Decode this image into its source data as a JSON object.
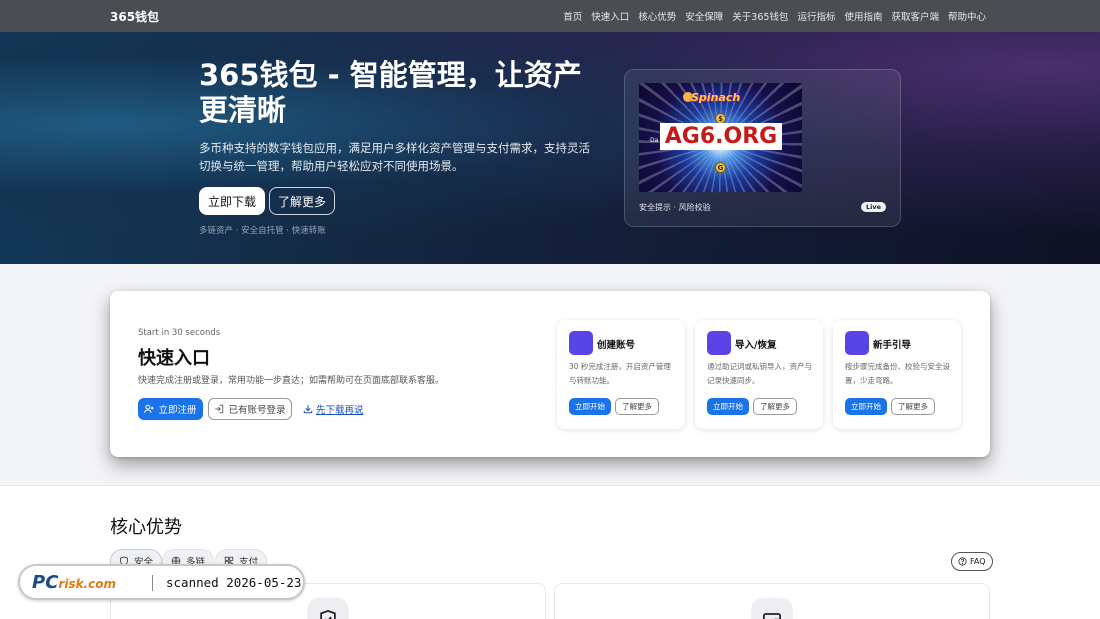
{
  "nav": {
    "brand": "365钱包",
    "links": [
      "首页",
      "快速入口",
      "核心优势",
      "安全保障",
      "关于365钱包",
      "运行指标",
      "使用指南",
      "获取客户端",
      "帮助中心"
    ]
  },
  "hero": {
    "title": "365钱包 - 智能管理，让资产更清晰",
    "description": "多币种支持的数字钱包应用，满足用户多样化资产管理与支付需求，支持灵活切换与统一管理，帮助用户轻松应对不同使用场景。",
    "download_label": "立即下载",
    "learn_label": "了解更多",
    "tags": "多链资产 · 安全自托管 · 快速转账",
    "card": {
      "promo_brand": "Spinach",
      "promo_headline": "AG6.ORG",
      "promo_small": "Da",
      "caption": "安全提示 · 风险校验",
      "badge": "Live"
    }
  },
  "quick": {
    "eyebrow": "Start in 30 seconds",
    "title": "快速入口",
    "description": "快速完成注册或登录，常用功能一步直达；如需帮助可在页面底部联系客服。",
    "register_label": "立即注册",
    "login_label": "已有账号登录",
    "download_link": "先下载再说",
    "cards": [
      {
        "title": "创建账号",
        "desc": "30 秒完成注册，开启资产管理与转账功能。",
        "start": "立即开始",
        "more": "了解更多"
      },
      {
        "title": "导入/恢复",
        "desc": "通过助记词或私钥导入，资产与记录快速同步。",
        "start": "立即开始",
        "more": "了解更多"
      },
      {
        "title": "新手引导",
        "desc": "按步骤完成备份、校验与安全设置，少走弯路。",
        "start": "立即开始",
        "more": "了解更多"
      }
    ]
  },
  "advantages": {
    "title": "核心优势",
    "chips": [
      "安全",
      "多链",
      "支付"
    ],
    "faq": "FAQ"
  },
  "watermark": {
    "logo_main": "PC",
    "logo_sub": "risk.com",
    "text": "scanned 2026-05-23"
  }
}
